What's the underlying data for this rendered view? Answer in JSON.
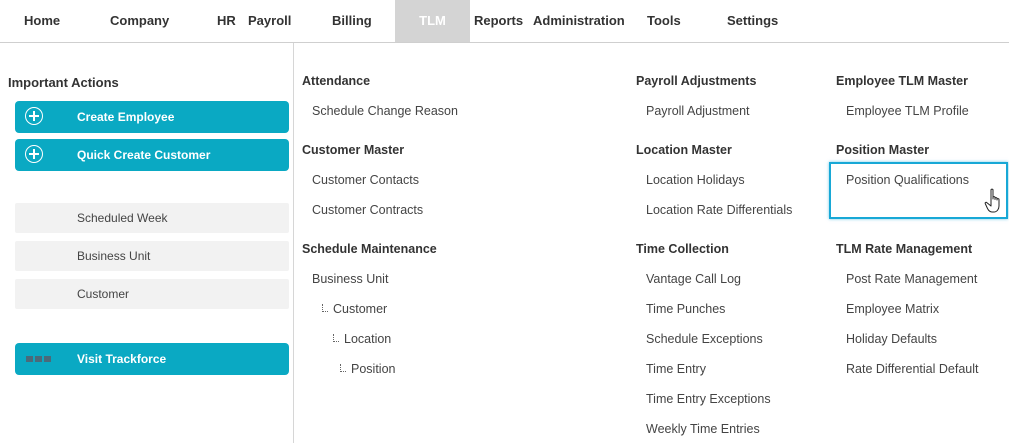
{
  "nav": {
    "items": [
      "Home",
      "Company",
      "HR",
      "Payroll",
      "Billing",
      "TLM",
      "Reports",
      "Administration",
      "Tools",
      "Settings"
    ],
    "active": "TLM"
  },
  "left": {
    "title": "Important Actions",
    "actions": [
      {
        "label": "Create Employee",
        "icon": "plus-circle-icon"
      },
      {
        "label": "Quick Create Customer",
        "icon": "plus-circle-icon"
      }
    ],
    "shortcuts": [
      "Scheduled Week",
      "Business Unit",
      "Customer"
    ],
    "visit": {
      "label": "Visit Trackforce",
      "icon": "trackforce-logo-icon"
    }
  },
  "menu": {
    "col1": {
      "attendance": {
        "heading": "Attendance",
        "links": [
          "Schedule Change Reason"
        ]
      },
      "customer_master": {
        "heading": "Customer Master",
        "links": [
          "Customer Contacts",
          "Customer Contracts"
        ]
      },
      "schedule_maintenance": {
        "heading": "Schedule Maintenance",
        "links": [
          "Business Unit",
          "Customer",
          "Location",
          "Position"
        ]
      }
    },
    "col2": {
      "payroll_adjustments": {
        "heading": "Payroll Adjustments",
        "links": [
          "Payroll Adjustment"
        ]
      },
      "location_master": {
        "heading": "Location Master",
        "links": [
          "Location Holidays",
          "Location Rate Differentials"
        ]
      },
      "time_collection": {
        "heading": "Time Collection",
        "links": [
          "Vantage Call Log",
          "Time Punches",
          "Schedule Exceptions",
          "Time Entry",
          "Time Entry Exceptions",
          "Weekly Time Entries"
        ]
      }
    },
    "col3": {
      "employee_tlm_master": {
        "heading": "Employee TLM Master",
        "links": [
          "Employee TLM Profile"
        ]
      },
      "position_master": {
        "heading": "Position Master",
        "links": [
          "Position Qualifications"
        ]
      },
      "tlm_rate_management": {
        "heading": "TLM Rate Management",
        "links": [
          "Post Rate Management",
          "Employee Matrix",
          "Holiday Defaults",
          "Rate Differential Default"
        ]
      }
    }
  },
  "colors": {
    "accent": "#0aa9c3",
    "highlight": "#18a8d6",
    "active_tab_bg": "#d4d4d4"
  },
  "cursor": {
    "icon": "hand-pointer-icon"
  }
}
